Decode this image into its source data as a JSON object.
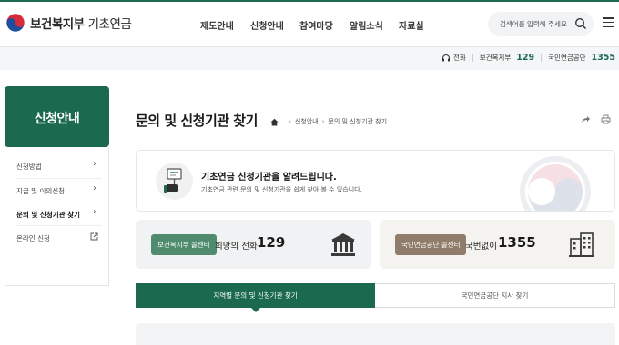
{
  "header": {
    "logo": {
      "main": "보건복지부",
      "sub": "기초연금"
    },
    "nav": [
      "제도안내",
      "신청안내",
      "참여마당",
      "알림소식",
      "자료실"
    ],
    "search": {
      "placeholder": "검색어를 입력해 주세요"
    }
  },
  "contact_strip": {
    "phone_label": "전화",
    "org1": {
      "name": "보건복지부",
      "number": "129"
    },
    "org2": {
      "name": "국민연금공단",
      "number": "1355"
    }
  },
  "sidebar": {
    "title": "신청안내",
    "items": [
      {
        "label": "신청방법",
        "active": false
      },
      {
        "label": "지급 및 이의신청",
        "active": false
      },
      {
        "label": "문의 및 신청기관 찾기",
        "active": true
      },
      {
        "label": "온라인 신청",
        "active": false
      }
    ]
  },
  "main": {
    "title": "문의 및 신청기관 찾기",
    "breadcrumb": [
      "신청안내",
      "문의 및 신청기관 찾기"
    ],
    "info": {
      "title": "기초연금 신청기관을 알려드립니다.",
      "desc": "기초연금 관련 문의 및 신청기관을 쉽게 찾아 볼 수 있습니다."
    },
    "cards": [
      {
        "badge": "보건복지부 콜센터",
        "text": "희망의 전화",
        "number": "129"
      },
      {
        "badge": "국민연금공단 콜센터",
        "text": "국번없이",
        "number": "1355"
      }
    ],
    "tabs": [
      "지역별 문의 및 신청기관 찾기",
      "국민연금공단 지사 찾기"
    ]
  },
  "colors": {
    "primary": "#1b6a4f",
    "badge_green": "#4f8b6d",
    "badge_brown": "#8f7c6a"
  }
}
